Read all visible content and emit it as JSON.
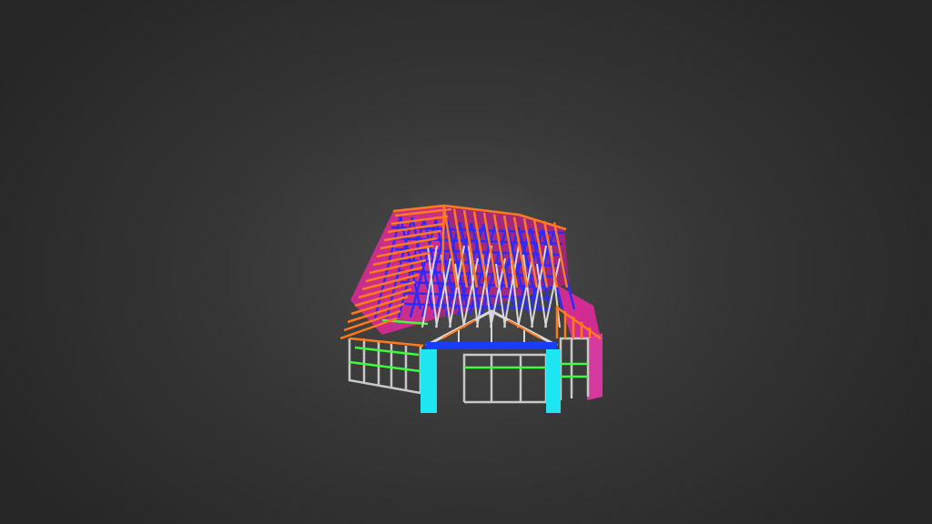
{
  "scene": {
    "model": "timber-house-frame-wireframe",
    "palette": {
      "background": "#333333",
      "rafter_orange": "#ff7a1a",
      "roof_magenta": "#ff2fa8",
      "truss_blue": "#2b2bff",
      "wall_grey": "#c8c8c8",
      "nogging_green": "#3cff3c",
      "post_cyan": "#1ee6f0",
      "lintel_blue": "#1a3cff"
    }
  }
}
